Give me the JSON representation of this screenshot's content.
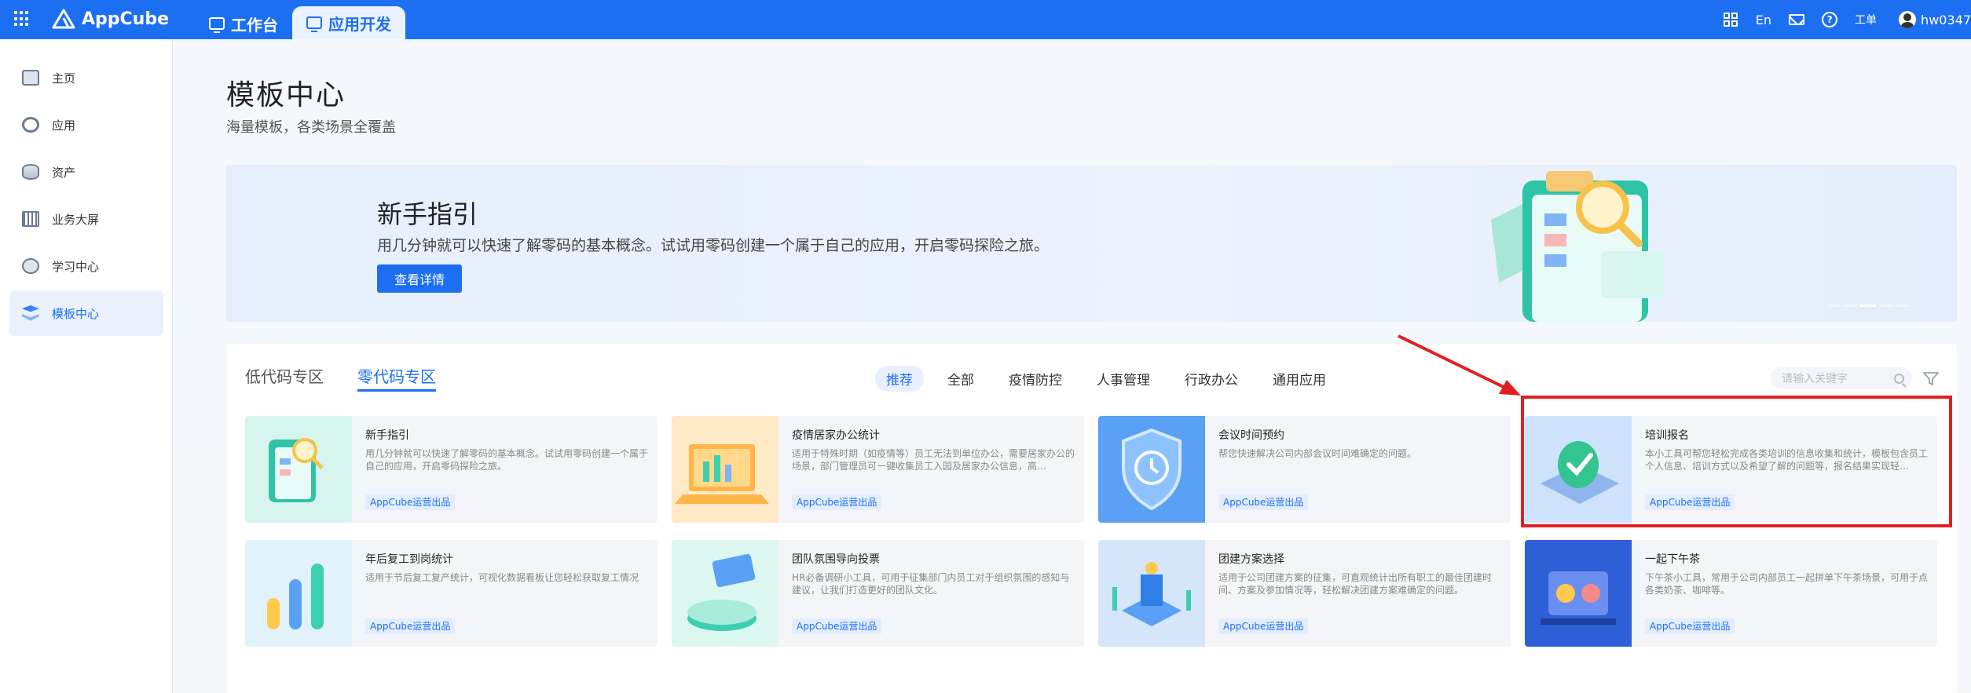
{
  "topbar": {
    "brand": "AppCube",
    "tabs": [
      {
        "label": "工作台"
      },
      {
        "label": "应用开发"
      }
    ],
    "lang": "En",
    "ticket": "工单",
    "username": "hw0347"
  },
  "sidebar": {
    "items": [
      {
        "label": "主页",
        "icon": "home-icon"
      },
      {
        "label": "应用",
        "icon": "app-icon"
      },
      {
        "label": "资产",
        "icon": "asset-icon"
      },
      {
        "label": "业务大屏",
        "icon": "dashboard-icon"
      },
      {
        "label": "学习中心",
        "icon": "learning-icon"
      },
      {
        "label": "模板中心",
        "icon": "template-icon",
        "active": true
      }
    ]
  },
  "page": {
    "title": "模板中心",
    "subtitle": "海量模板，各类场景全覆盖"
  },
  "banner": {
    "title": "新手指引",
    "desc": "用几分钟就可以快速了解零码的基本概念。试试用零码创建一个属于自己的应用，开启零码探险之旅。",
    "button": "查看详情"
  },
  "zones": {
    "tab1": "低代码专区",
    "tab2": "零代码专区"
  },
  "categories": [
    "推荐",
    "全部",
    "疫情防控",
    "人事管理",
    "行政办公",
    "通用应用"
  ],
  "search": {
    "placeholder": "请输入关键字"
  },
  "cards": [
    {
      "title": "新手指引",
      "desc": "用几分钟就可以快速了解零码的基本概念。试试用零码创建一个属于自己的应用，开启零码探险之旅。",
      "badge": "AppCube运营出品"
    },
    {
      "title": "疫情居家办公统计",
      "desc": "适用于特殊时期（如疫情等）员工无法到单位办公，需要居家办公的场景，部门管理员可一键收集员工入园及居家办公信息，高…",
      "badge": "AppCube运营出品"
    },
    {
      "title": "会议时间预约",
      "desc": "帮您快速解决公司内部会议时间难确定的问题。",
      "badge": "AppCube运营出品"
    },
    {
      "title": "培训报名",
      "desc": "本小工具可帮您轻松完成各类培训的信息收集和统计，模板包含员工个人信息、培训方式以及希望了解的问题等，报名结果实现轻…",
      "badge": "AppCube运营出品"
    },
    {
      "title": "年后复工到岗统计",
      "desc": "适用于节后复工复产统计，可视化数据看板让您轻松获取复工情况",
      "badge": "AppCube运营出品"
    },
    {
      "title": "团队氛围导向投票",
      "desc": "HR必备调研小工具，可用于征集部门内员工对于组织氛围的感知与建议，让我们打造更好的团队文化。",
      "badge": "AppCube运营出品"
    },
    {
      "title": "团建方案选择",
      "desc": "适用于公司团建方案的征集，可直观统计出所有职工的最佳团建时间、方案及参加情况等，轻松解决团建方案难确定的问题。",
      "badge": "AppCube运营出品"
    },
    {
      "title": "一起下午茶",
      "desc": "下午茶小工具，常用于公司内部员工一起拼单下午茶场景，可用于点各类奶茶、咖啡等。",
      "badge": "AppCube运营出品"
    }
  ],
  "colors": {
    "primary": "#1d6ff2",
    "annotation": "#e02020"
  }
}
